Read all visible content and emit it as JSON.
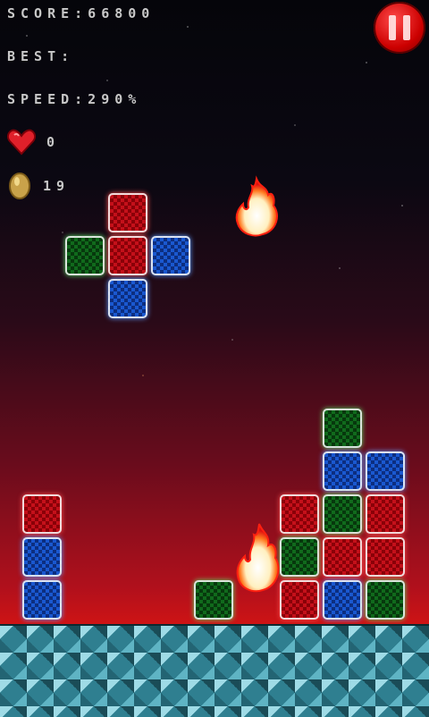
{
  "hud": {
    "score_text": "SCORE:66800",
    "best_text": "BEST:",
    "speed_text": "SPEED:290%",
    "lives": "0",
    "coins": "19"
  },
  "icons": {
    "heart": "heart-icon",
    "coin": "coin-icon",
    "pause": "pause-icon",
    "fireball": "fireball-icon"
  },
  "colors": {
    "red_block": "#c4101a",
    "blue_block": "#1a58d0",
    "green_block": "#106a1c",
    "pause_button": "#cc0000"
  },
  "board": {
    "falling_piece": [
      "red",
      "green",
      "red",
      "blue",
      "blue"
    ],
    "stack": [
      "red",
      "blue",
      "blue",
      "green",
      "red",
      "green",
      "red",
      "green",
      "blue",
      "green",
      "red",
      "blue",
      "blue",
      "red",
      "red",
      "green"
    ]
  }
}
